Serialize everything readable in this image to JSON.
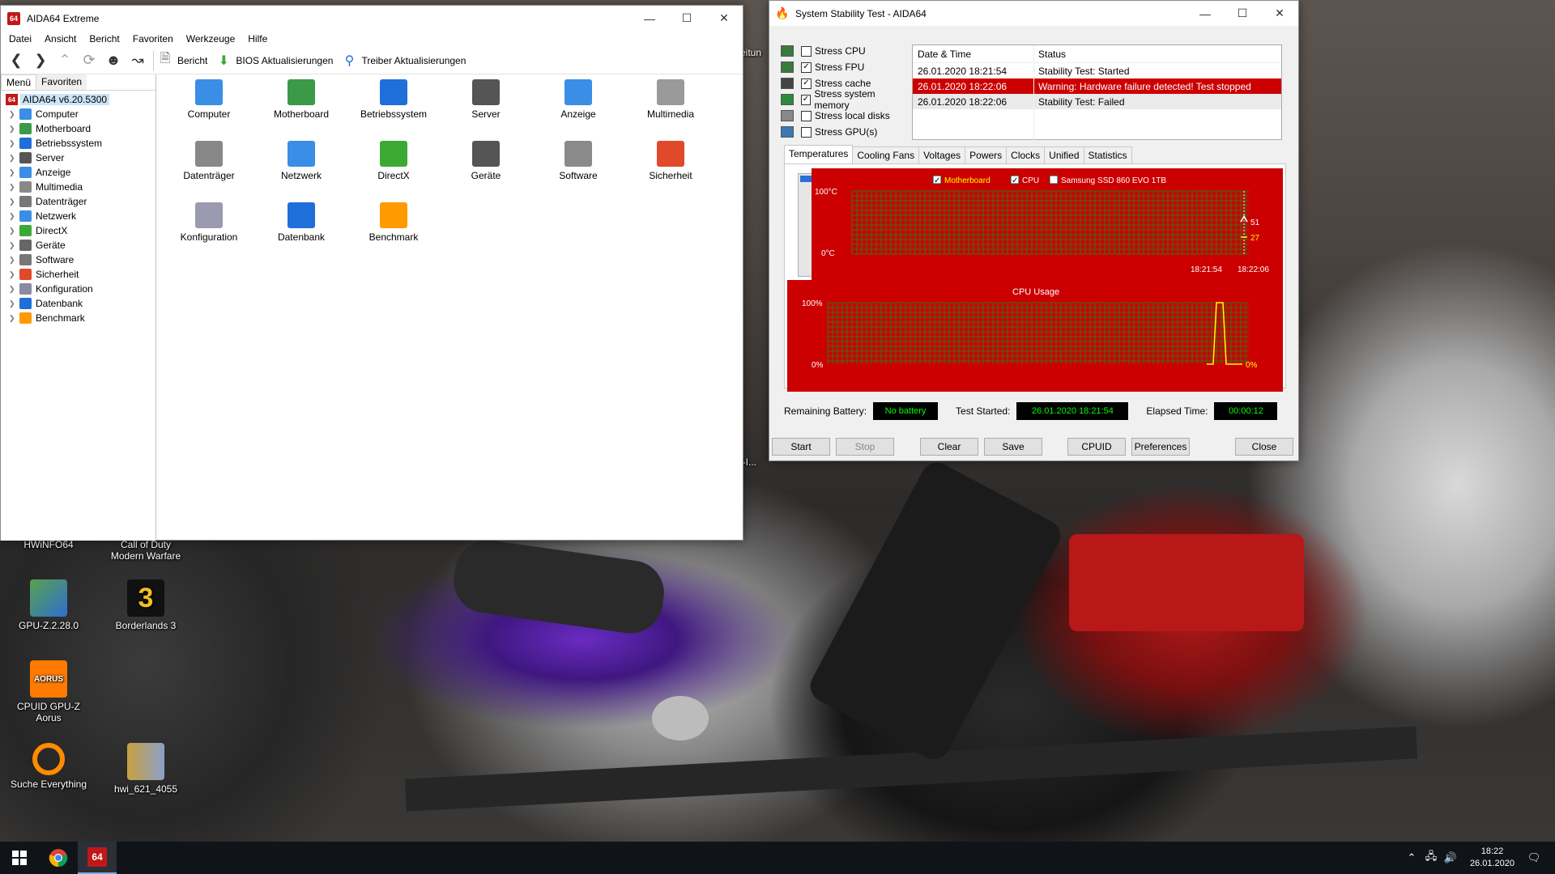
{
  "desktop": {
    "icons": [
      {
        "label": "HWiNFO64",
        "icon": "hwinfo-icon",
        "color": "#2d6fd0"
      },
      {
        "label": "Call of Duty Modern Warfare",
        "icon": "cod-icon",
        "color": "#222222"
      },
      {
        "label": "GPU-Z.2.28.0",
        "icon": "gpuz-icon",
        "color": "#5aa04c"
      },
      {
        "label": "Borderlands 3",
        "icon": "borderlands-icon",
        "color": "#f0c020"
      },
      {
        "label": "CPUID GPU-Z Aorus",
        "icon": "aorus-icon",
        "color": "#ff7a00"
      },
      {
        "label": "Suche Everything",
        "icon": "everything-icon",
        "color": "#ff8c00"
      },
      {
        "label": "hwi_621_4055",
        "icon": "archive-icon",
        "color": "#c8a040"
      },
      {
        "label": "ator-I...",
        "icon": "partial-icon",
        "color": "#444444"
      },
      {
        "label": "eitun",
        "icon": "partial-icon-2",
        "color": "#444444"
      }
    ]
  },
  "aida": {
    "title": "AIDA64 Extreme",
    "app_icon": "64",
    "menu": [
      "Datei",
      "Ansicht",
      "Bericht",
      "Favoriten",
      "Werkzeuge",
      "Hilfe"
    ],
    "toolbar": {
      "report": "Bericht",
      "bios": "BIOS Aktualisierungen",
      "driver": "Treiber Aktualisierungen"
    },
    "tabs": {
      "menu": "Menü",
      "favorites": "Favoriten"
    },
    "tree_root": "AIDA64 v6.20.5300",
    "tree": [
      {
        "label": "Computer",
        "color": "#3a8ee6"
      },
      {
        "label": "Motherboard",
        "color": "#3b9a47"
      },
      {
        "label": "Betriebssystem",
        "color": "#1e6fd9"
      },
      {
        "label": "Server",
        "color": "#555555"
      },
      {
        "label": "Anzeige",
        "color": "#3a8ee6"
      },
      {
        "label": "Multimedia",
        "color": "#888888"
      },
      {
        "label": "Datenträger",
        "color": "#777777"
      },
      {
        "label": "Netzwerk",
        "color": "#3a8ee6"
      },
      {
        "label": "DirectX",
        "color": "#3aaa35"
      },
      {
        "label": "Geräte",
        "color": "#666666"
      },
      {
        "label": "Software",
        "color": "#777777"
      },
      {
        "label": "Sicherheit",
        "color": "#e04a2a"
      },
      {
        "label": "Konfiguration",
        "color": "#8a8aa0"
      },
      {
        "label": "Datenbank",
        "color": "#1e6fd9"
      },
      {
        "label": "Benchmark",
        "color": "#ff9a00"
      }
    ],
    "content_icons": [
      {
        "label": "Computer",
        "color": "#3a8ee6"
      },
      {
        "label": "Motherboard",
        "color": "#3b9a47"
      },
      {
        "label": "Betriebssystem",
        "color": "#1e6fd9"
      },
      {
        "label": "Server",
        "color": "#555555"
      },
      {
        "label": "Anzeige",
        "color": "#3a8ee6"
      },
      {
        "label": "Multimedia",
        "color": "#9a9a9a"
      },
      {
        "label": "Datenträger",
        "color": "#888888"
      },
      {
        "label": "Netzwerk",
        "color": "#3a8ee6"
      },
      {
        "label": "DirectX",
        "color": "#3aaa35"
      },
      {
        "label": "Geräte",
        "color": "#555555"
      },
      {
        "label": "Software",
        "color": "#8a8a8a"
      },
      {
        "label": "Sicherheit",
        "color": "#e04a2a"
      },
      {
        "label": "Konfiguration",
        "color": "#9a9ab0"
      },
      {
        "label": "Datenbank",
        "color": "#1e6fd9"
      },
      {
        "label": "Benchmark",
        "color": "#ff9a00"
      }
    ]
  },
  "sst": {
    "title": "System Stability Test - AIDA64",
    "stress": [
      {
        "label": "Stress CPU",
        "checked": false
      },
      {
        "label": "Stress FPU",
        "checked": true
      },
      {
        "label": "Stress cache",
        "checked": true
      },
      {
        "label": "Stress system memory",
        "checked": true
      },
      {
        "label": "Stress local disks",
        "checked": false
      },
      {
        "label": "Stress GPU(s)",
        "checked": false
      }
    ],
    "log_headers": {
      "date": "Date & Time",
      "status": "Status"
    },
    "log": [
      {
        "date": "26.01.2020 18:21:54",
        "status": "Stability Test: Started",
        "kind": "normal"
      },
      {
        "date": "26.01.2020 18:22:06",
        "status": "Warning: Hardware failure detected! Test stopped",
        "kind": "warn"
      },
      {
        "date": "26.01.2020 18:22:06",
        "status": "Stability Test: Failed",
        "kind": "fail"
      }
    ],
    "graph_tabs": [
      "Temperatures",
      "Cooling Fans",
      "Voltages",
      "Powers",
      "Clocks",
      "Unified",
      "Statistics"
    ],
    "temp_legend": [
      {
        "label": "Motherboard",
        "checked": true,
        "color": "#ffff00"
      },
      {
        "label": "CPU",
        "checked": true,
        "color": "#ffffff"
      },
      {
        "label": "Samsung SSD 860 EVO 1TB",
        "checked": false,
        "color": "#ffffff"
      }
    ],
    "bottom": {
      "battery_label": "Remaining Battery:",
      "battery_value": "No battery",
      "started_label": "Test Started:",
      "started_value": "26.01.2020 18:21:54",
      "elapsed_label": "Elapsed Time:",
      "elapsed_value": "00:00:12"
    },
    "buttons": {
      "start": "Start",
      "stop": "Stop",
      "clear": "Clear",
      "save": "Save",
      "cpuid": "CPUID",
      "preferences": "Preferences",
      "close": "Close"
    }
  },
  "chart_data": [
    {
      "type": "line",
      "title": "",
      "ylim": [
        0,
        100
      ],
      "y_tick_labels": [
        "100°C",
        "0°C"
      ],
      "x_tick_labels": [
        "18:21:54",
        "18:22:06"
      ],
      "series": [
        {
          "name": "Motherboard",
          "color": "#ffff00",
          "values": [
            27,
            27
          ],
          "end_label": "27"
        },
        {
          "name": "CPU",
          "color": "#ffffff",
          "values": [
            51,
            60,
            51
          ],
          "end_label": "51"
        }
      ],
      "background": "#cc0000",
      "grid": true
    },
    {
      "type": "line",
      "title": "CPU Usage",
      "ylim": [
        0,
        100
      ],
      "y_tick_labels": [
        "100%",
        "0%"
      ],
      "series": [
        {
          "color": "#ffff00",
          "values": [
            0,
            0,
            100,
            100,
            0,
            0
          ],
          "end_label": "0%"
        }
      ],
      "background": "#cc0000",
      "grid": true
    }
  ],
  "taskbar": {
    "items": [
      "windows-start",
      "chrome",
      "aida64"
    ],
    "time": "18:22",
    "date": "26.01.2020",
    "aida_label": "64"
  }
}
